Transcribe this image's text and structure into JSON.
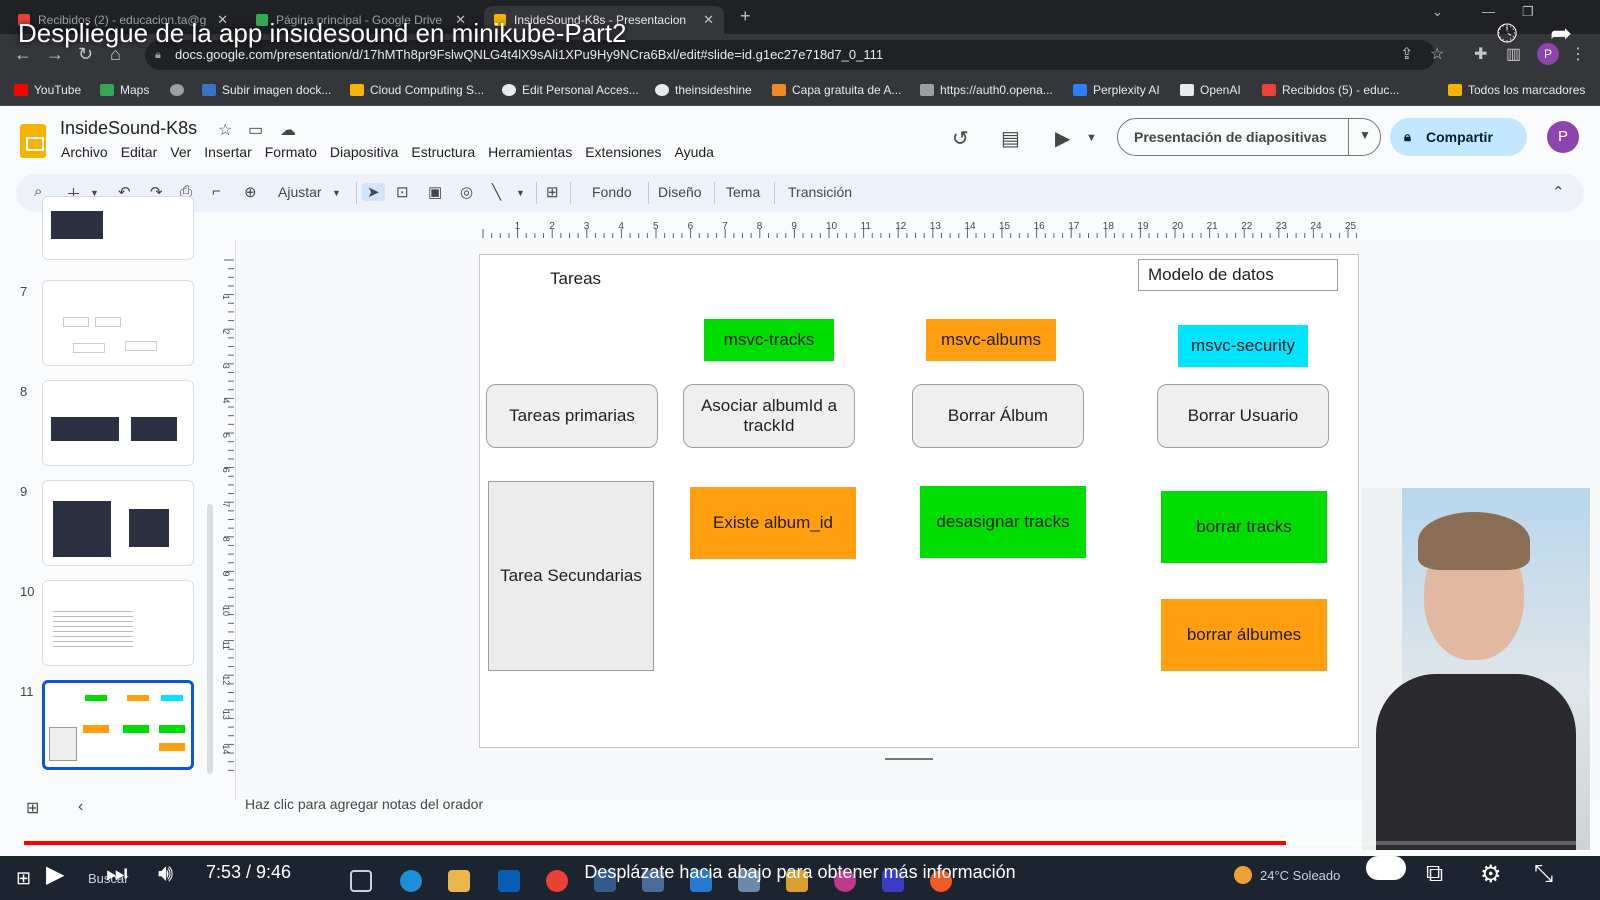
{
  "video": {
    "title": "Despliegue de la app insidesound en minikube-Part2",
    "time": "7:53 / 9:46",
    "progress": 0.813,
    "loaded": 0.86,
    "scroll_hint": "Desplázate hacia abajo para obtener más información"
  },
  "browser": {
    "tabs": [
      {
        "label": "Recibidos (2) - educacion.ta@g",
        "color": "#ea4335"
      },
      {
        "label": "Página principal - Google Drive",
        "color": "#34a853"
      },
      {
        "label": "InsideSound-K8s - Presentacion",
        "color": "#f4b400"
      }
    ],
    "url": "docs.google.com/presentation/d/17hMTh8pr9FslwQNLG4t4lX9sAli1XPu9Hy9NCra6Bxl/edit#slide=id.g1ec27e718d7_0_111",
    "bookmarks": [
      {
        "label": "YouTube",
        "color": "#ff0000"
      },
      {
        "label": "Maps",
        "color": "#34a853"
      },
      {
        "label": "",
        "color": "#9aa0a6"
      },
      {
        "label": "Subir imagen dock...",
        "color": "#3b73c4"
      },
      {
        "label": "Cloud Computing S...",
        "color": "#f4b400"
      },
      {
        "label": "Edit Personal Acces...",
        "color": "#e8eaed"
      },
      {
        "label": "theinsideshine",
        "color": "#e8eaed"
      },
      {
        "label": "Capa gratuita de A...",
        "color": "#f08a24"
      },
      {
        "label": "https://auth0.opena...",
        "color": "#9aa0a6"
      },
      {
        "label": "Perplexity AI",
        "color": "#2a7fff"
      },
      {
        "label": "OpenAI",
        "color": "#e8eaed"
      },
      {
        "label": "Recibidos (5) - educ...",
        "color": "#ea4335"
      },
      {
        "label": "Todos los marcadores",
        "color": "#f4b400"
      }
    ]
  },
  "doc": {
    "title": "InsideSound-K8s",
    "menu": [
      "Archivo",
      "Editar",
      "Ver",
      "Insertar",
      "Formato",
      "Diapositiva",
      "Estructura",
      "Herramientas",
      "Extensiones",
      "Ayuda"
    ],
    "present_label": "Presentación de diapositivas",
    "share_label": "Compartir",
    "avatar_letter": "P"
  },
  "toolbar": {
    "zoom_label": "Ajustar",
    "fondo": "Fondo",
    "diseno": "Diseño",
    "tema": "Tema",
    "transicion": "Transición"
  },
  "filmstrip": {
    "numbers": [
      "7",
      "8",
      "9",
      "10",
      "11"
    ]
  },
  "ruler": {
    "h_ticks": [
      "1",
      "2",
      "3",
      "4",
      "5",
      "6",
      "7",
      "8",
      "9",
      "10",
      "11",
      "12",
      "13",
      "14",
      "15",
      "16",
      "17",
      "18",
      "19",
      "20",
      "21",
      "22",
      "23",
      "24",
      "25"
    ],
    "v_ticks": [
      "1",
      "2",
      "3",
      "4",
      "5",
      "6",
      "7",
      "8",
      "9",
      "10",
      "11",
      "12",
      "13",
      "14"
    ]
  },
  "slide": {
    "tareas": "Tareas",
    "modelo": "Modelo de datos",
    "msvc_tracks": "msvc-tracks",
    "msvc_albums": "msvc-albums",
    "msvc_security": "msvc-security",
    "tareas_primarias": "Tareas primarias",
    "asociar": "Asociar albumId a trackId",
    "borrar_album": "Borrar Álbum",
    "borrar_usuario": "Borrar Usuario",
    "tarea_secundarias": "Tarea Secundarias",
    "existe_album": "Existe album_id",
    "desasignar": "desasignar tracks",
    "borrar_tracks": "borrar tracks",
    "borrar_albumes": "borrar álbumes"
  },
  "notes_placeholder": "Haz clic para agregar notas del orador",
  "taskbar": {
    "search": "Buscar",
    "weather": "24°C  Soleado"
  },
  "colors": {
    "green": "#00dd00",
    "orange": "#ff9e0f",
    "cyan": "#00e5ff",
    "accent": "#0b57d0"
  }
}
